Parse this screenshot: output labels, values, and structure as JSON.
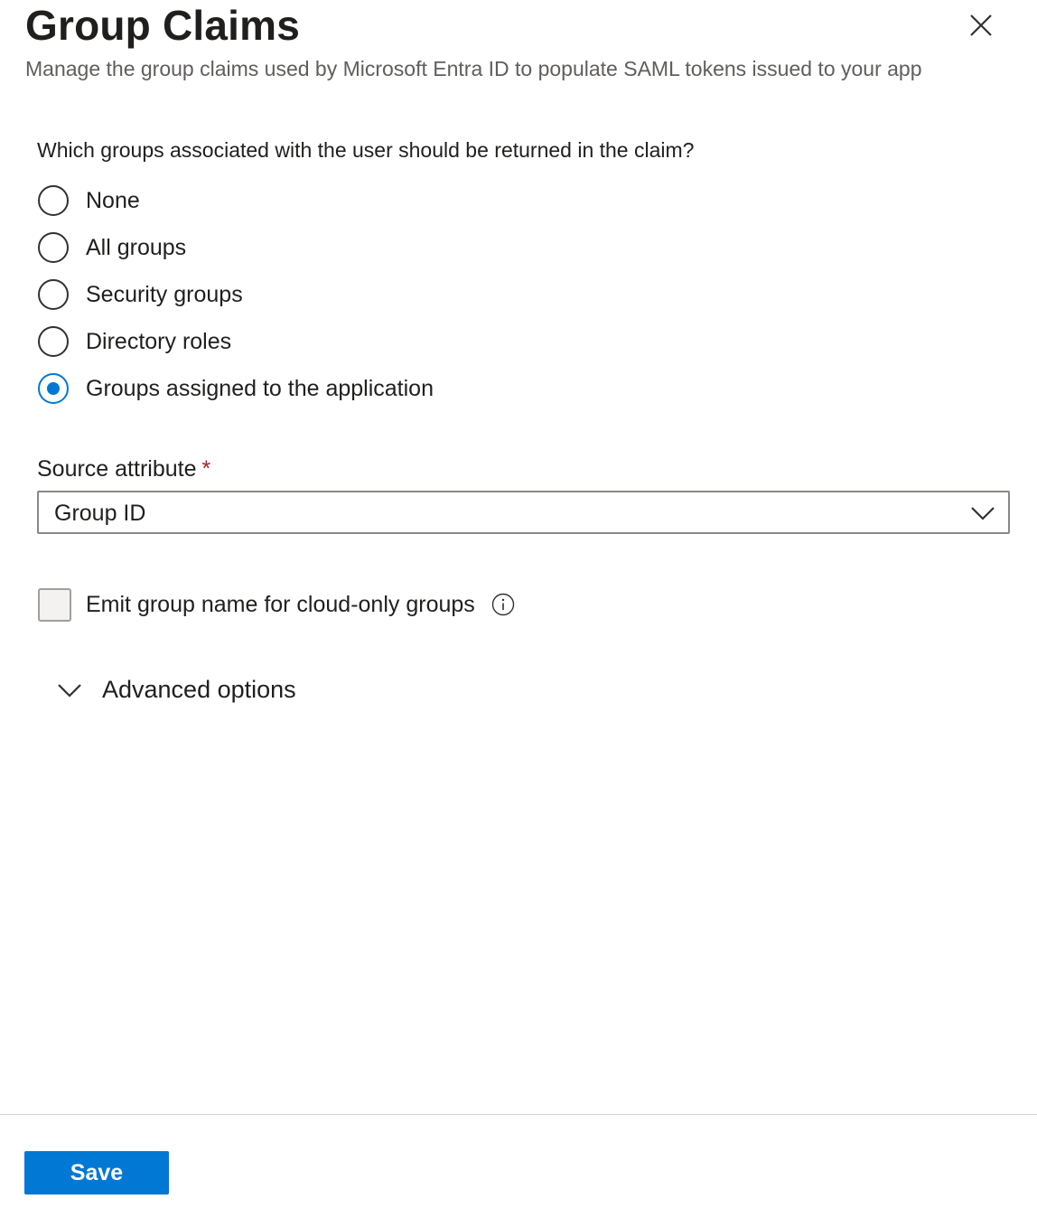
{
  "header": {
    "title": "Group Claims",
    "subtitle": "Manage the group claims used by Microsoft Entra ID to populate SAML tokens issued to your app",
    "close_icon": "close-icon"
  },
  "question": {
    "label": "Which groups associated with the user should be returned in the claim?",
    "options": [
      {
        "label": "None",
        "checked": false
      },
      {
        "label": "All groups",
        "checked": false
      },
      {
        "label": "Security groups",
        "checked": false
      },
      {
        "label": "Directory roles",
        "checked": false
      },
      {
        "label": "Groups assigned to the application",
        "checked": true
      }
    ],
    "selected_color": "#0078d4"
  },
  "source_attribute": {
    "label": "Source attribute",
    "required_marker": "*",
    "value": "Group ID",
    "icon": "chevron-down-icon"
  },
  "emit_group_name": {
    "label": "Emit group name for cloud-only groups",
    "checked": false,
    "icon": "info-icon"
  },
  "advanced": {
    "label": "Advanced options",
    "expanded": false,
    "icon": "chevron-down-icon"
  },
  "footer": {
    "save_label": "Save",
    "save_color": "#0078d4"
  }
}
